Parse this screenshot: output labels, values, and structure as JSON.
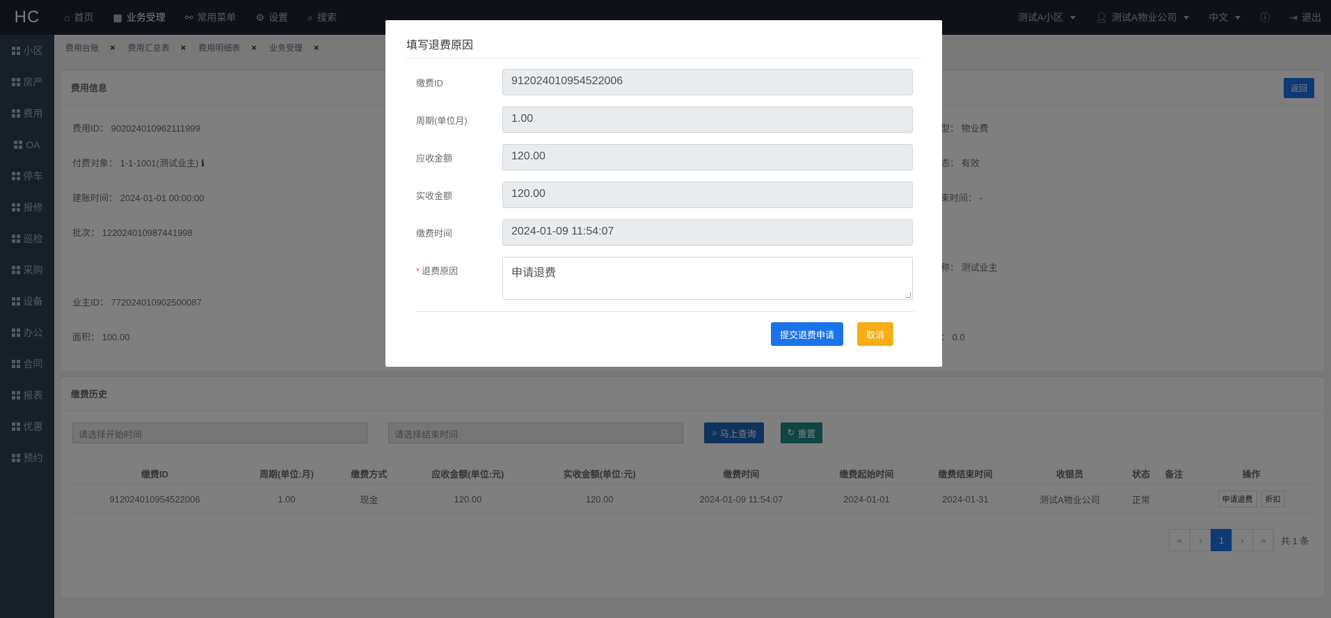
{
  "topbar": {
    "logo": "HC",
    "nav": [
      {
        "label": "首页",
        "icon": "home-icon"
      },
      {
        "label": "业务受理",
        "icon": "table-icon"
      },
      {
        "label": "常用菜单",
        "icon": "sitemap-icon"
      },
      {
        "label": "设置",
        "icon": "gear-icon"
      },
      {
        "label": "搜索",
        "icon": "search-icon"
      }
    ],
    "community": "测试A小区",
    "company": "测试A物业公司",
    "language": "中文",
    "help_icon": "question-icon",
    "logout": "退出"
  },
  "sidebar": {
    "items": [
      "小区",
      "房产",
      "费用",
      "OA",
      "停车",
      "报修",
      "巡检",
      "采购",
      "设备",
      "办公",
      "合同",
      "报表",
      "优惠",
      "预约"
    ]
  },
  "tabs": [
    "费用台账",
    "费用汇总表",
    "费用明细表",
    "业务受理"
  ],
  "fee_info": {
    "title": "费用信息",
    "back": "返回",
    "fee_id": "费用ID：  902024010962111999",
    "payer": "付费对象：  1-1-1001(测试业主)",
    "created": "建账时间：  2024-01-01 00:00:00",
    "batch": "批次：  122024010987441998",
    "owner_id": "业主ID：  772024010902500087",
    "area": "面积：  100.00",
    "fee_type": "型：  物业费",
    "state": "态：  有效",
    "end_time": "束时间：  -",
    "owner_name": "称：  测试业主",
    "other": "：  0.0"
  },
  "history": {
    "title": "缴费历史",
    "start_placeholder": "请选择开始时间",
    "end_placeholder": "请选择结束时间",
    "search_btn": "马上查询",
    "reset_btn": "重置",
    "columns": [
      "缴费ID",
      "周期(单位:月)",
      "缴费方式",
      "应收金额(单位:元)",
      "实收金额(单位:元)",
      "缴费时间",
      "缴费起始时间",
      "缴费结束时间",
      "收银员",
      "状态",
      "备注",
      "操作"
    ],
    "rows": [
      {
        "id": "912024010954522006",
        "cycle": "1.00",
        "method": "现金",
        "receivable": "120.00",
        "received": "120.00",
        "pay_time": "2024-01-09 11:54:07",
        "start": "2024-01-01",
        "end": "2024-01-31",
        "cashier": "测试A物业公司",
        "status": "正常",
        "remark": "",
        "op1": "申请退费",
        "op2": "折扣"
      }
    ],
    "pager": {
      "first": "«",
      "prev": "‹",
      "page": "1",
      "next": "›",
      "last": "»",
      "total": "共 1 条"
    }
  },
  "modal": {
    "title": "填写退费原因",
    "fields": [
      {
        "label": "缴费ID",
        "value": "912024010954522006"
      },
      {
        "label": "周期(单位月)",
        "value": "1.00"
      },
      {
        "label": "应收金额",
        "value": "120.00"
      },
      {
        "label": "实收金额",
        "value": "120.00"
      },
      {
        "label": "缴费时间",
        "value": "2024-01-09 11:54:07"
      }
    ],
    "reason_required": "*",
    "reason_label": "退费原因",
    "reason_value": "申请退费",
    "submit": "提交退费申请",
    "cancel": "取消"
  },
  "colors": {
    "topbar": "#1e2333",
    "sidebar": "#2f4050",
    "primary": "#1a73e8",
    "search_btn": "#1c66b8",
    "reset_btn": "#1e8a86",
    "cancel_btn": "#f8ac15"
  }
}
